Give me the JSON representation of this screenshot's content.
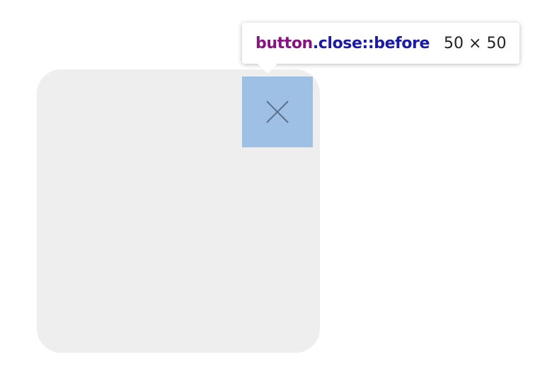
{
  "tooltip": {
    "tag": "button",
    "selector_rest": ".close::before",
    "size": "50 × 50"
  },
  "colors": {
    "card_background": "#eeeeee",
    "highlight_overlay": "#9dc0e4",
    "close_icon_stroke": "#5a6f88",
    "tag_color": "#881280",
    "class_color": "#1a1aa6"
  },
  "icons": {
    "close": "close-icon"
  }
}
